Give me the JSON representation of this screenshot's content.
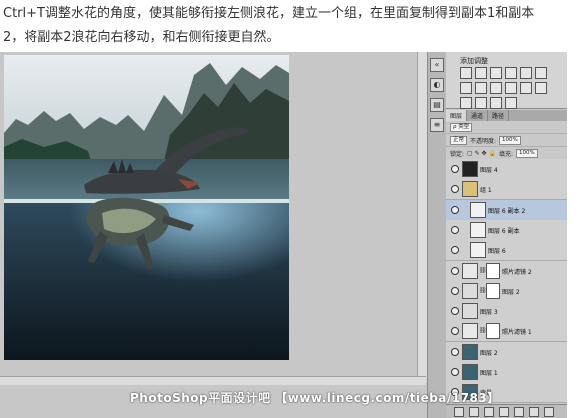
{
  "instruction": {
    "line1": "Ctrl+T调整水花的角度，使其能够衔接左侧浪花，建立一个组，在里面复制得到副本1和副本",
    "line2": "2，将副本2浪花向右移动，和右侧衔接更自然。"
  },
  "panels": {
    "adjustments_title": "添加调整",
    "layers": {
      "tabs": [
        "图层",
        "通道",
        "路径"
      ],
      "search_kind": "ρ 类型",
      "blend_mode": "正常",
      "opacity_label": "不透明度:",
      "opacity_value": "100%",
      "lock_label": "锁定:",
      "fill_label": "填充:",
      "fill_value": "100%",
      "rows": [
        {
          "name": "图层 4",
          "kind": "dark",
          "indent": 0,
          "selected": false
        },
        {
          "name": "组 1",
          "kind": "group",
          "indent": 0,
          "selected": false
        },
        {
          "name": "图层 6 副本 2",
          "kind": "splash",
          "indent": 1,
          "selected": true
        },
        {
          "name": "图层 6 副本",
          "kind": "splash",
          "indent": 1,
          "selected": false
        },
        {
          "name": "图层 6",
          "kind": "splash",
          "indent": 1,
          "selected": false
        },
        {
          "name": "照片滤镜 2",
          "kind": "adjust",
          "indent": 0,
          "selected": false
        },
        {
          "name": "图层 2",
          "kind": "light",
          "indent": 0,
          "selected": false
        },
        {
          "name": "图层 3",
          "kind": "light",
          "indent": 0,
          "selected": false
        },
        {
          "name": "照片滤镜 1",
          "kind": "adjust",
          "indent": 0,
          "selected": false
        },
        {
          "name": "图层 2",
          "kind": "scene",
          "indent": 0,
          "selected": false
        },
        {
          "name": "图层 1",
          "kind": "scene",
          "indent": 0,
          "selected": false
        },
        {
          "name": "背景",
          "kind": "scene",
          "indent": 0,
          "selected": false
        }
      ]
    }
  },
  "watermark": "PhotoShop平面设计吧 【www.linecg.com/tieba/1783】"
}
